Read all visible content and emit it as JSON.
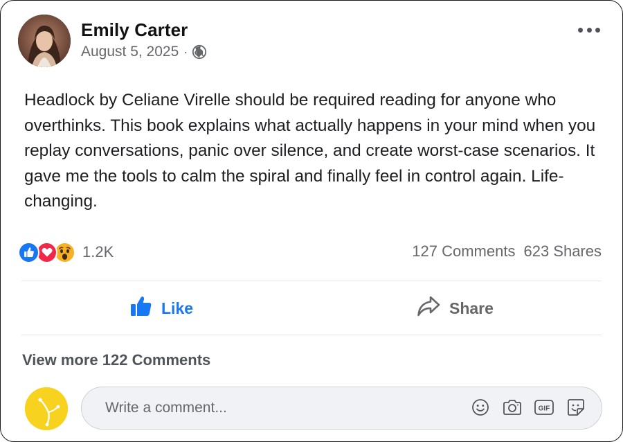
{
  "post": {
    "author": "Emily Carter",
    "date": "August 5, 2025",
    "separator": "·",
    "privacy_icon": "globe-icon",
    "text": "Headlock by Celiane Virelle should be required reading for anyone who overthinks. This book explains what actually happens in your mind when you replay conversations, panic over silence, and create worst-case scenarios. It gave me the tools to calm the spiral and finally feel in control again. Life-changing."
  },
  "reactions": {
    "types": [
      "like",
      "love",
      "wow"
    ],
    "count": "1.2K",
    "comments": "127 Comments",
    "shares": "623 Shares"
  },
  "actions": {
    "like_label": "Like",
    "share_label": "Share"
  },
  "comments": {
    "view_more": "View more 122 Comments",
    "placeholder": "Write a comment...",
    "composer_icons": [
      "emoji-icon",
      "camera-icon",
      "gif-icon",
      "sticker-icon"
    ]
  },
  "colors": {
    "accent": "#1877f2",
    "love": "#f02849",
    "wow": "#f7b125",
    "muted_text": "#65676b"
  }
}
